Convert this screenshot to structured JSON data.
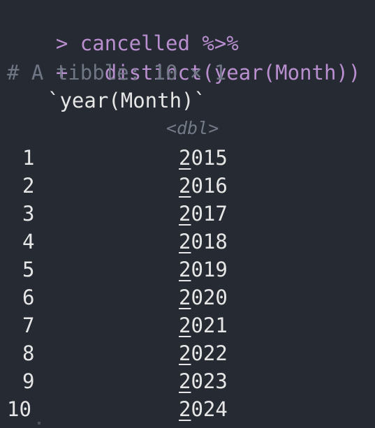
{
  "console": {
    "prompt_symbol": ">",
    "continuation_symbol": "+",
    "command_line_1": "cancelled %>%",
    "command_line_2": "  distinct(year(Month))",
    "tibble_header": "# A tibble: 10 × 1",
    "column_name": "`year(Month)`",
    "column_type": "<dbl>",
    "rows": [
      {
        "index": "1",
        "value": "2015"
      },
      {
        "index": "2",
        "value": "2016"
      },
      {
        "index": "3",
        "value": "2017"
      },
      {
        "index": "4",
        "value": "2018"
      },
      {
        "index": "5",
        "value": "2019"
      },
      {
        "index": "6",
        "value": "2020"
      },
      {
        "index": "7",
        "value": "2021"
      },
      {
        "index": "8",
        "value": "2022"
      },
      {
        "index": "9",
        "value": "2023"
      },
      {
        "index": "10",
        "value": "2024"
      }
    ]
  },
  "colors": {
    "background": "#262a33",
    "command": "#ba8fd0",
    "comment": "#6f7684",
    "text": "#e6e6e6",
    "type_annotation": "#737b88"
  }
}
